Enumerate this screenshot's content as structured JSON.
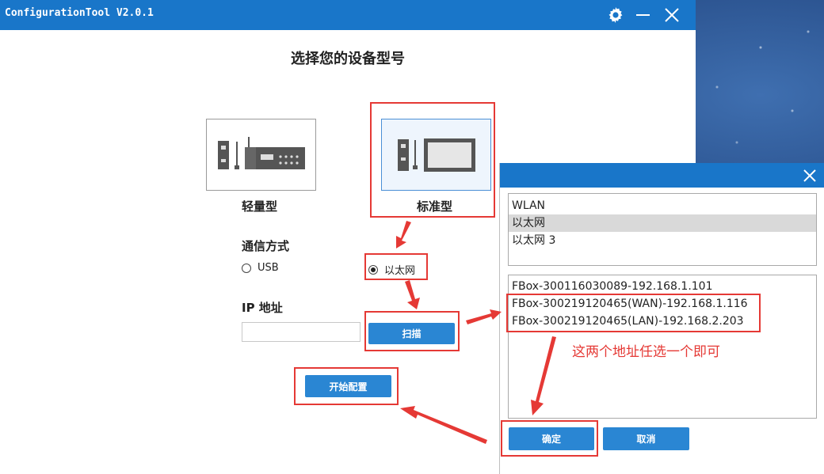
{
  "window": {
    "title": "ConfigurationTool V2.0.1",
    "controls": [
      "gear-icon",
      "minimize-icon",
      "close-icon"
    ]
  },
  "main": {
    "heading": "选择您的设备型号",
    "devices": [
      {
        "label": "轻量型",
        "selected": false
      },
      {
        "label": "标准型",
        "selected": true
      }
    ],
    "comm": {
      "label": "通信方式",
      "options": [
        {
          "label": "USB",
          "selected": false
        },
        {
          "label": "以太网",
          "selected": true
        }
      ]
    },
    "ip": {
      "label": "IP 地址",
      "value": ""
    },
    "scan_button": "扫描",
    "start_button": "开始配置"
  },
  "dialog": {
    "adapters": [
      {
        "label": "WLAN",
        "selected": false
      },
      {
        "label": "以太网",
        "selected": true
      },
      {
        "label": "以太网 3",
        "selected": false
      }
    ],
    "devices": [
      "FBox-300116030089-192.168.1.101",
      "FBox-300219120465(WAN)-192.168.1.116",
      "FBox-300219120465(LAN)-192.168.2.203"
    ],
    "ok_button": "确定",
    "cancel_button": "取消"
  },
  "annotation": {
    "note": "这两个地址任选一个即可",
    "color": "#e53935"
  },
  "colors": {
    "accent": "#1976c9",
    "button": "#2a86d3"
  }
}
